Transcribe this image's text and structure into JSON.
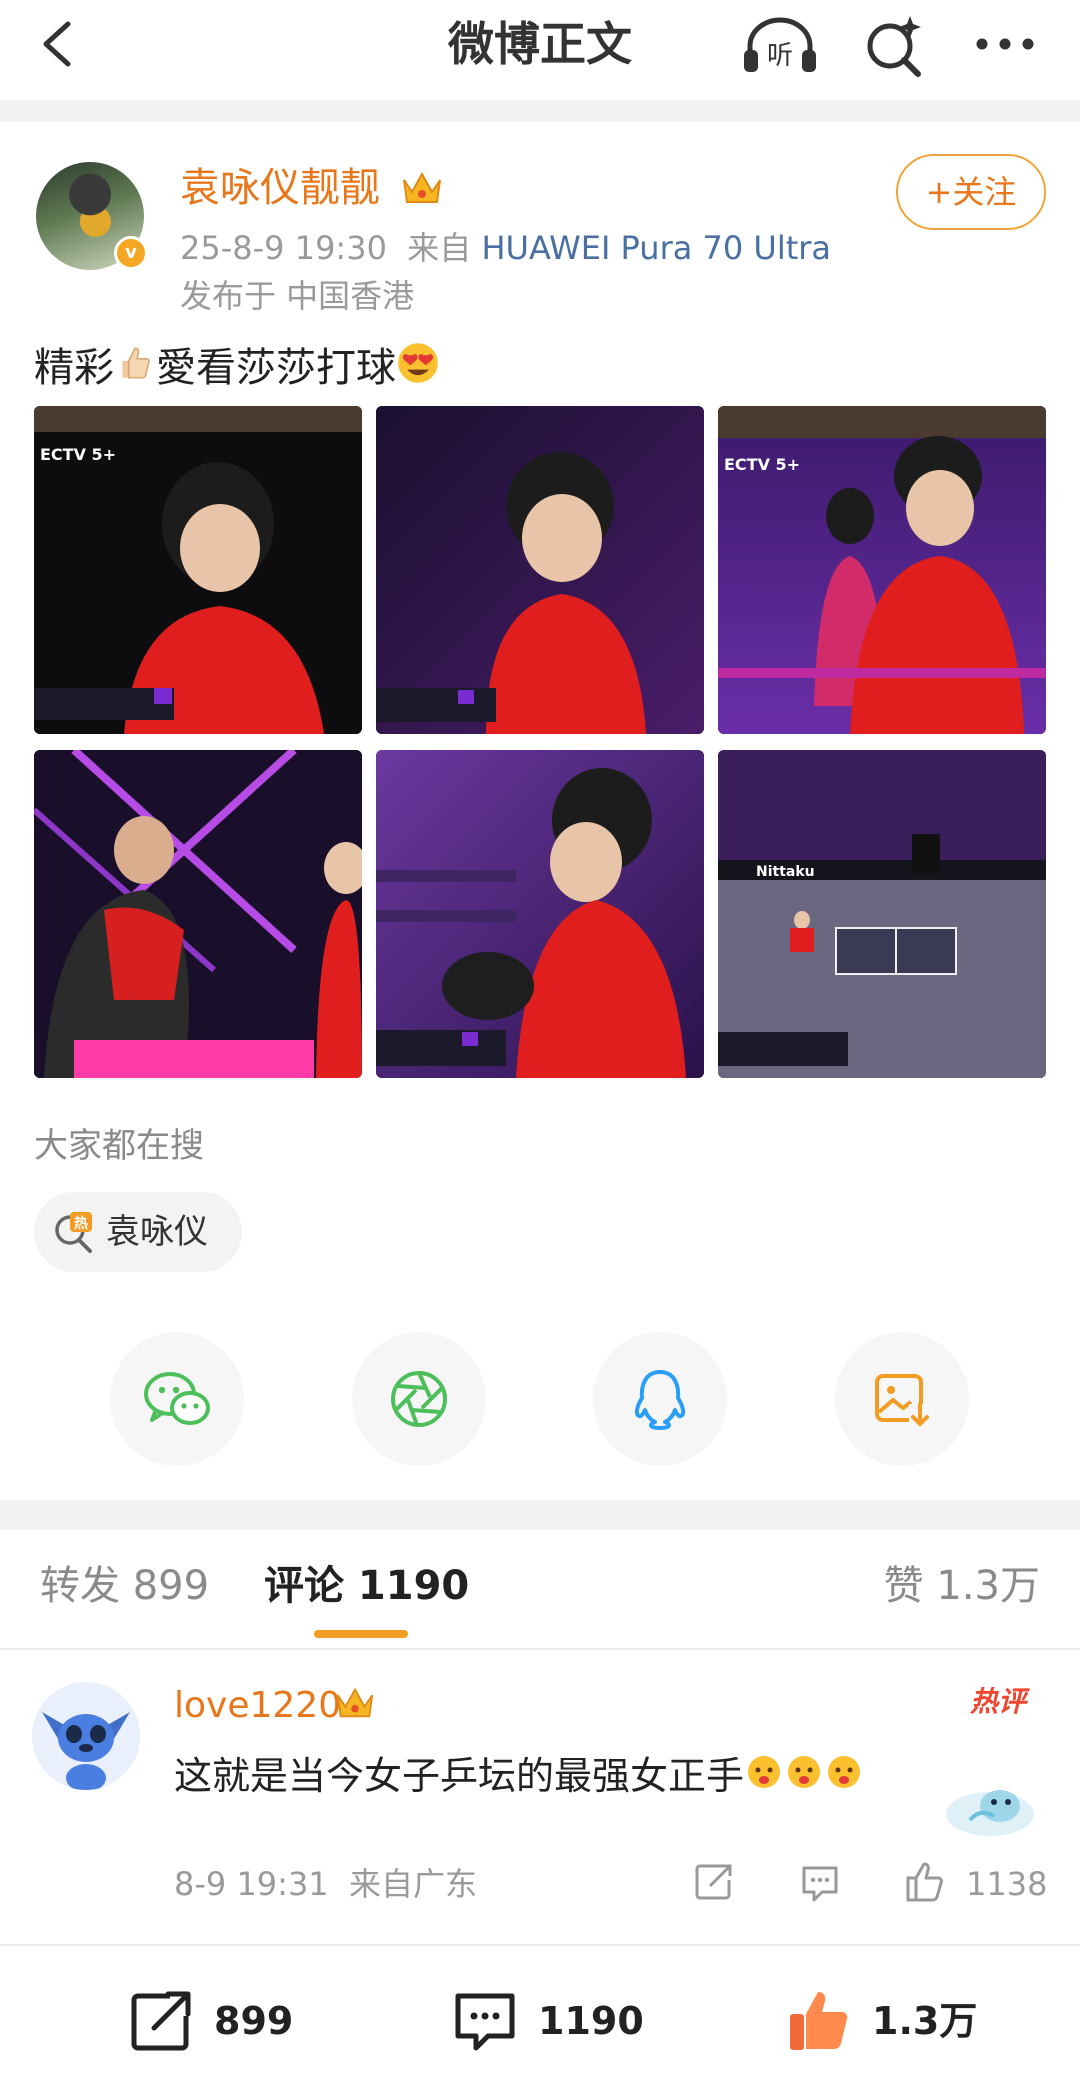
{
  "nav": {
    "title": "微博正文",
    "listen_label": "听"
  },
  "post": {
    "username": "袁咏仪靓靓",
    "verified_badge": "v",
    "time": "25-8-9 19:30",
    "source_prefix": "来自",
    "device": "HUAWEI Pura 70 Ultra",
    "location": "发布于 中国香港",
    "follow_label": "+关注",
    "text_part1": "精彩",
    "text_part2": "愛看莎莎打球",
    "photos": [
      {
        "label": "ECTV 5+"
      },
      {
        "label": ""
      },
      {
        "label": "ECTV 5+"
      },
      {
        "label": ""
      },
      {
        "label": ""
      },
      {
        "label": "Nittaku"
      }
    ]
  },
  "search": {
    "label": "大家都在搜",
    "hot_badge": "热",
    "chip": "袁咏仪"
  },
  "share": {
    "items": [
      "wechat-icon",
      "moments-icon",
      "qq-icon",
      "save-image-icon"
    ]
  },
  "tabs": {
    "repost": "转发 899",
    "comment": "评论 1190",
    "like": "赞 1.3万"
  },
  "comment": {
    "username": "love1220",
    "hot_tag": "热评",
    "text": "这就是当今女子乒坛的最强女正手",
    "time": "8-9 19:31",
    "location": "来自广东",
    "like_count": "1138"
  },
  "bottom": {
    "repost_count": "899",
    "comment_count": "1190",
    "like_count": "1.3万"
  },
  "colors": {
    "accent_orange": "#e8761b",
    "device_blue": "#4a6fa1",
    "tab_underline": "#f39c23",
    "hot_red": "#f0452e"
  }
}
